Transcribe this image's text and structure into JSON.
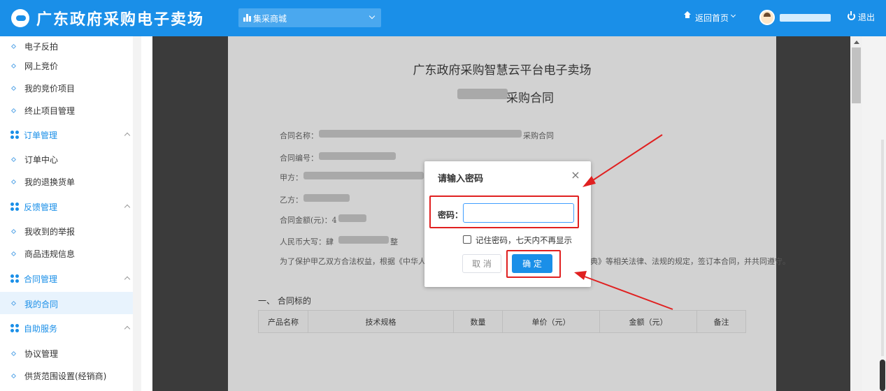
{
  "header": {
    "logo_text": "广东政府采购电子卖场",
    "mall_select_label": "集采商城",
    "home_link": "返回首页",
    "logout": "退出"
  },
  "sidebar": {
    "items_top": [
      "电子反拍",
      "网上竞价",
      "我的竞价项目",
      "终止项目管理"
    ],
    "group_order": "订单管理",
    "order_items": [
      "订单中心",
      "我的退换货单"
    ],
    "group_feedback": "反馈管理",
    "feedback_items": [
      "我收到的举报",
      "商品违规信息"
    ],
    "group_contract": "合同管理",
    "contract_items": [
      "我的合同"
    ],
    "group_selfservice": "自助服务",
    "selfservice_items": [
      "协议管理",
      "供货范围设置(经销商)"
    ]
  },
  "document": {
    "title": "广东政府采购智慧云平台电子卖场",
    "subtitle": "采购合同",
    "fields": {
      "name_label": "合同名称：",
      "name_suffix": "采购合同",
      "number_label": "合同编号：",
      "party_a_label": "甲方：",
      "party_b_label": "乙方：",
      "amount_label": "合同金额(元)：",
      "amount_prefix": "4",
      "rmb_label": "人民币大写：",
      "rmb_prefix": "肆",
      "rmb_suffix": "整"
    },
    "para_start": "为了保护甲乙双方合法权益，根据《中华人",
    "para_end": "典》等相关法律、法规的规定，签订本合同，并共同遵守。",
    "section_title": "一、 合同标的",
    "table_headers": [
      "产品名称",
      "技术规格",
      "数量",
      "单价（元）",
      "金额（元）",
      "备注"
    ]
  },
  "dialog": {
    "title": "请输入密码",
    "close": "×",
    "password_label": "密码：",
    "password_value": "",
    "remember_text": "记住密码，七天内不再显示",
    "cancel": "取 消",
    "confirm": "确 定"
  },
  "colors": {
    "brand": "#1a8fe8",
    "annotation_red": "#e02020"
  }
}
